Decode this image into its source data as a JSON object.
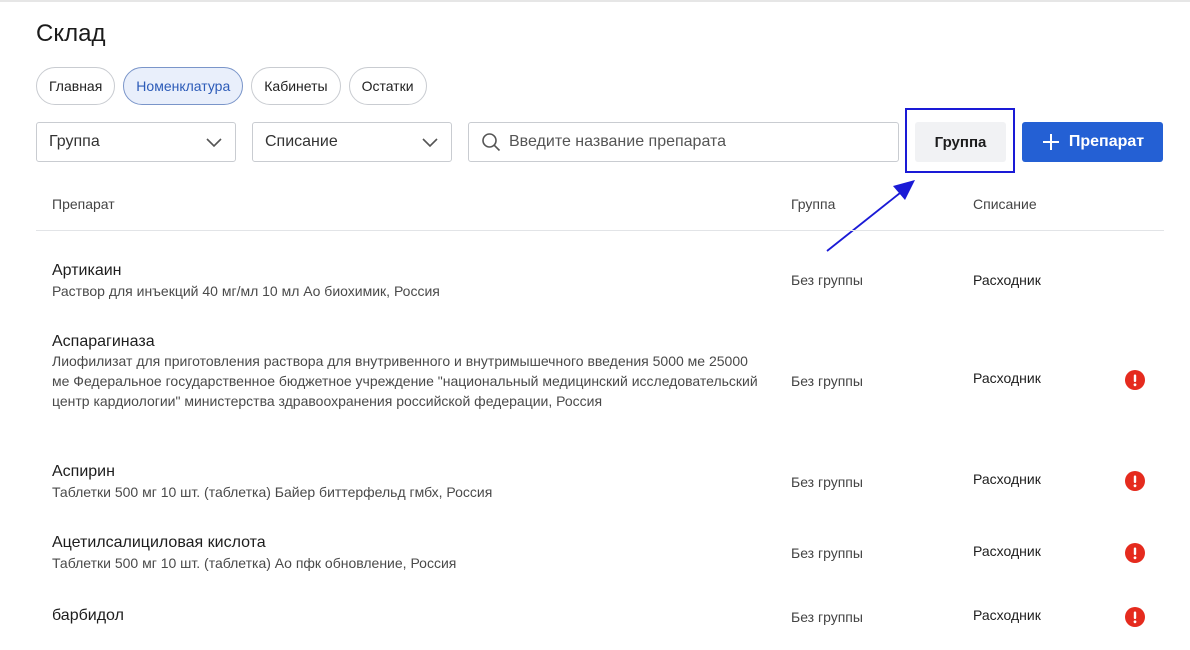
{
  "page": {
    "title": "Склад"
  },
  "tabs": [
    {
      "label": "Главная",
      "active": false
    },
    {
      "label": "Номенклатура",
      "active": true
    },
    {
      "label": "Кабинеты",
      "active": false
    },
    {
      "label": "Остатки",
      "active": false
    }
  ],
  "filters": {
    "group_select": {
      "value": "Группа",
      "icon": "chevron-down-icon"
    },
    "writeoff_select": {
      "value": "Списание",
      "icon": "chevron-down-icon"
    },
    "search": {
      "placeholder": "Введите название препарата",
      "value": "",
      "icon": "search-icon"
    }
  },
  "toolbar": {
    "group_button_label": "Группа",
    "add_button_label": "Препарат",
    "add_button_icon": "plus-icon"
  },
  "table": {
    "headers": [
      "Препарат",
      "Группа",
      "Списание"
    ],
    "rows": [
      {
        "name": "Артикаин",
        "description": "Раствор для инъекций 40 мг/мл 10 мл Ао биохимик, Россия",
        "group": "Без группы",
        "writeoff": "Расходник",
        "warning": false
      },
      {
        "name": "Аспарагиназа",
        "description": "Лиофилизат для приготовления раствора для внутривенного и внутримышечного введения 5000 ме 25000 ме Федеральное государственное бюджетное учреждение \"национальный медицинский исследовательский центр кардиологии\" министерства здравоохранения российской федерации, Россия",
        "group": "Без группы",
        "writeoff": "Расходник",
        "warning": true
      },
      {
        "name": "Аспирин",
        "description": "Таблетки 500 мг 10 шт. (таблетка) Байер биттерфельд гмбх, Россия",
        "group": "Без группы",
        "writeoff": "Расходник",
        "warning": true
      },
      {
        "name": "Ацетилсалициловая кислота",
        "description": "Таблетки 500 мг 10 шт. (таблетка) Ао пфк обновление, Россия",
        "group": "Без группы",
        "writeoff": "Расходник",
        "warning": true
      },
      {
        "name": "барбидол",
        "description": "",
        "group": "Без группы",
        "writeoff": "Расходник",
        "warning": true
      }
    ]
  },
  "colors": {
    "primary": "#2460d4",
    "active_tab_bg": "#e9effb",
    "warning": "#e52b1e",
    "annotation": "#1a1ad6"
  }
}
